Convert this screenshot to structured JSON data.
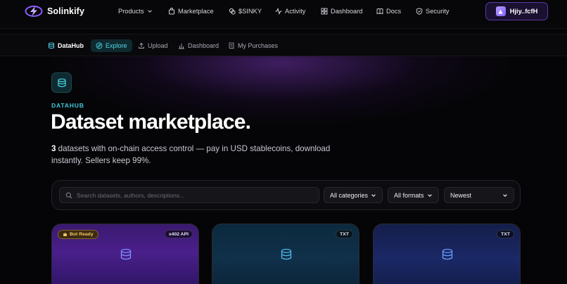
{
  "brand": {
    "name": "Solinkify"
  },
  "nav": {
    "items": [
      {
        "label": "Products",
        "icon": "chevron-down-icon"
      },
      {
        "label": "Marketplace",
        "icon": "bag-icon"
      },
      {
        "label": "$SINKY",
        "icon": "coins-icon"
      },
      {
        "label": "Activity",
        "icon": "activity-icon"
      },
      {
        "label": "Dashboard",
        "icon": "grid-icon"
      },
      {
        "label": "Docs",
        "icon": "book-icon"
      },
      {
        "label": "Security",
        "icon": "shield-icon"
      }
    ],
    "user_label": "Hjiy..fcfH"
  },
  "subnav": {
    "brand_label": "DataHub",
    "items": [
      {
        "label": "Explore",
        "active": true,
        "icon": "compass-icon"
      },
      {
        "label": "Upload",
        "icon": "upload-icon"
      },
      {
        "label": "Dashboard",
        "icon": "bar-chart-icon"
      },
      {
        "label": "My Purchases",
        "icon": "receipt-icon"
      }
    ]
  },
  "hero": {
    "eyebrow": "DATAHUB",
    "title": "Dataset marketplace.",
    "count": "3",
    "subtitle_rest": " datasets with on-chain access control — pay in USD stablecoins, download instantly. Sellers keep 99%."
  },
  "filters": {
    "search_placeholder": "Search datasets, authors, descriptions...",
    "category": "All categories",
    "format": "All formats",
    "sort": "Newest"
  },
  "cards": [
    {
      "badge": "Bot Ready",
      "tag": "x402 API",
      "icon": "database-icon"
    },
    {
      "tag": "TXT",
      "icon": "database-icon"
    },
    {
      "tag": "TXT",
      "icon": "database-icon"
    }
  ],
  "colors": {
    "accent_cyan": "#3ec7db",
    "accent_purple": "#5a3aa8",
    "badge_gold": "#f4c85a"
  }
}
